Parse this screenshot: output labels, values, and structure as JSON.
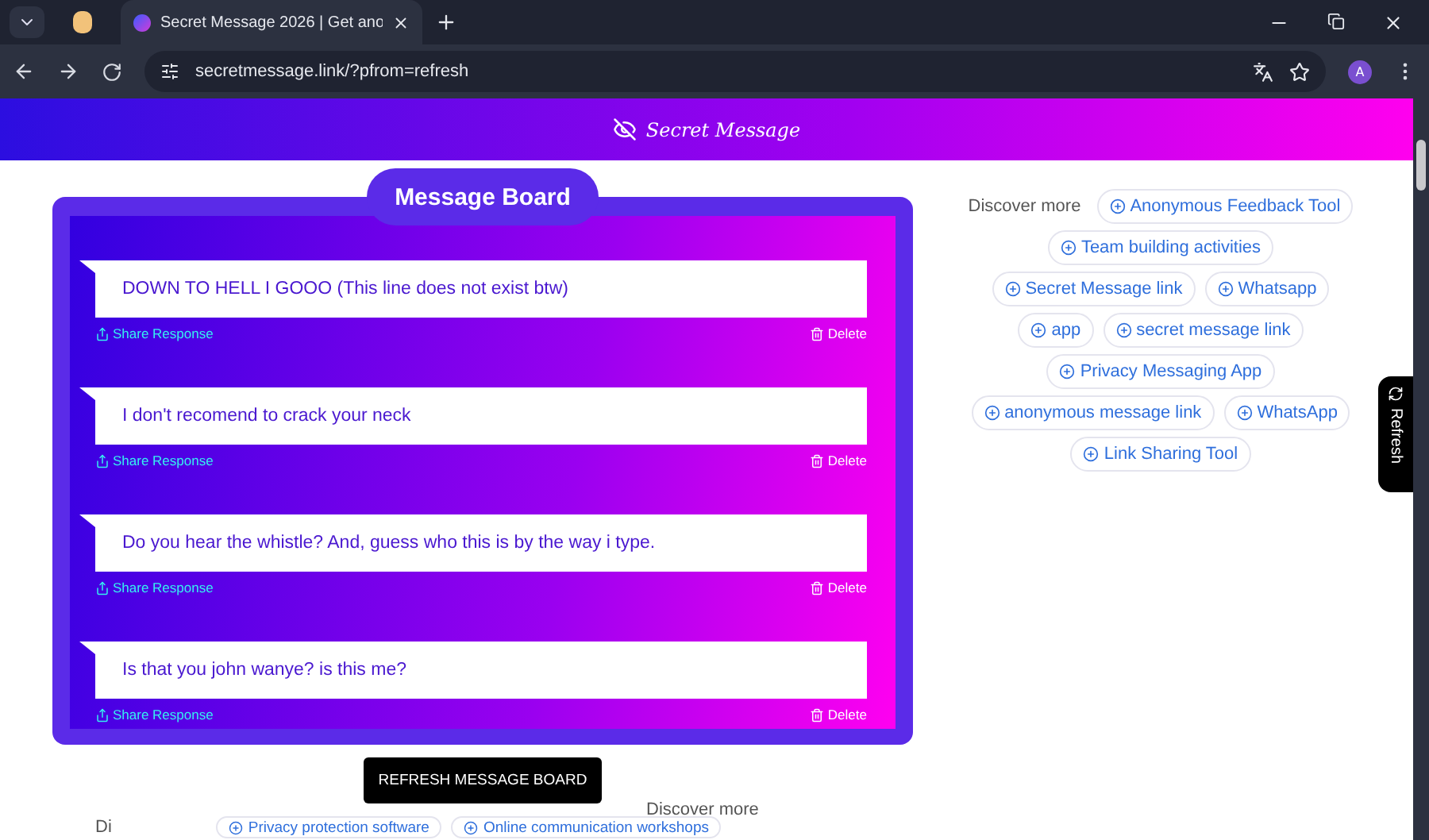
{
  "browser": {
    "tab_title": "Secret Message 2026 | Get ano",
    "url": "secretmessage.link/?pfrom=refresh",
    "profile_initial": "A"
  },
  "header": {
    "brand": "Secret Message"
  },
  "board": {
    "title": "Message Board",
    "messages": [
      {
        "text": "DOWN TO HELL I GOOO (This line does not exist btw)",
        "share": "Share Response",
        "delete": "Delete"
      },
      {
        "text": "I don't recomend to crack your neck",
        "share": "Share Response",
        "delete": "Delete"
      },
      {
        "text": "Do you hear the whistle? And, guess who this is by the way i type.",
        "share": "Share Response",
        "delete": "Delete"
      },
      {
        "text": "Is that you john wanye? is this me?",
        "share": "Share Response",
        "delete": "Delete"
      }
    ]
  },
  "refresh_button": "REFRESH MESSAGE BOARD",
  "discover": {
    "label": "Discover more",
    "chips": [
      "Anonymous Feedback Tool",
      "Team building activities",
      "Secret Message link",
      "Whatsapp",
      "app",
      "secret message link",
      "Privacy Messaging App",
      "anonymous message link",
      "WhatsApp",
      "Link Sharing Tool"
    ]
  },
  "side_tab": {
    "label": "Refresh"
  },
  "bottom_discover": {
    "label": "Discover more",
    "row_label": "Di",
    "chips": [
      "Privacy protection software",
      "Online communication workshops"
    ]
  }
}
